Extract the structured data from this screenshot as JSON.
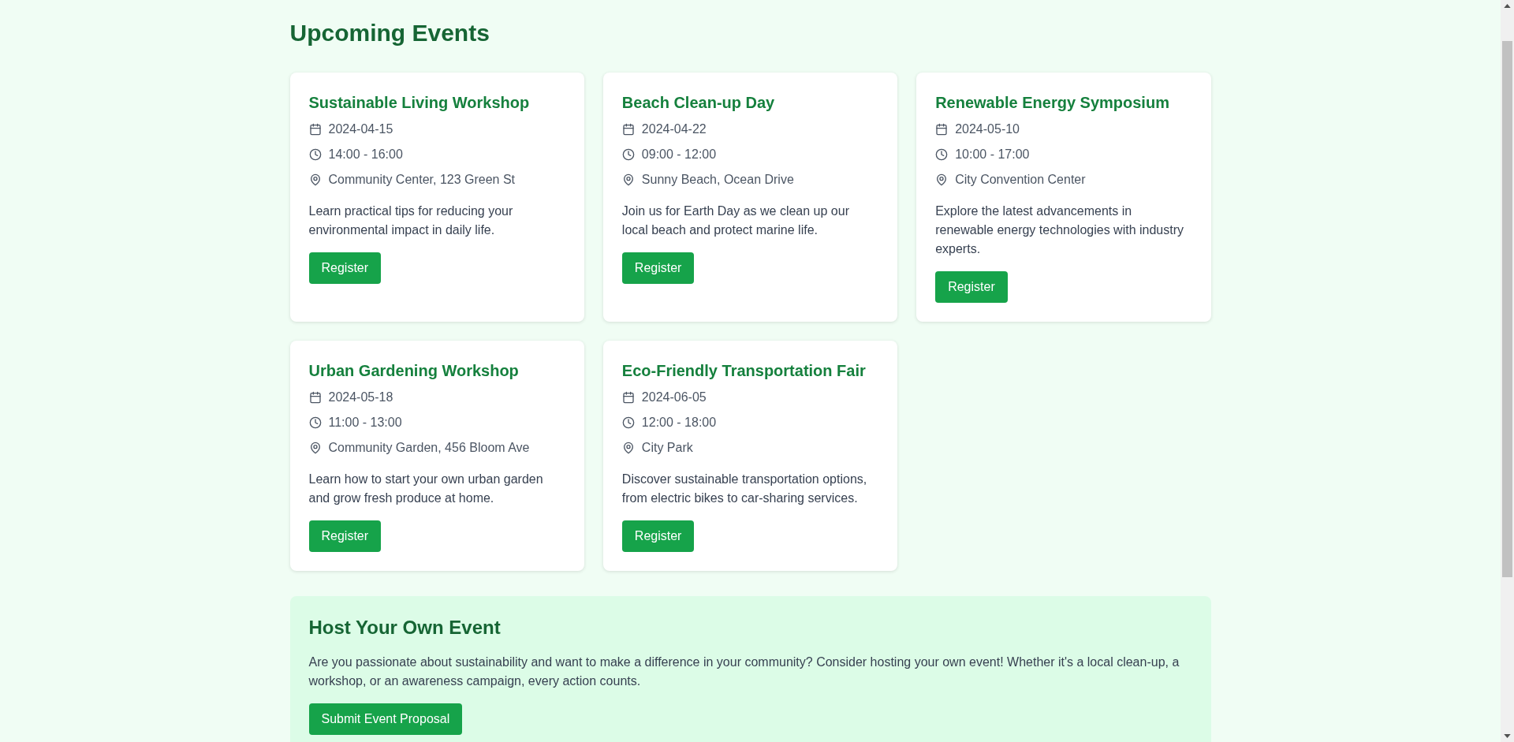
{
  "page_title": "Upcoming Events",
  "events": [
    {
      "title": "Sustainable Living Workshop",
      "date": "2024-04-15",
      "time": "14:00 - 16:00",
      "location": "Community Center, 123 Green St",
      "description": "Learn practical tips for reducing your environmental impact in daily life.",
      "button": "Register"
    },
    {
      "title": "Beach Clean-up Day",
      "date": "2024-04-22",
      "time": "09:00 - 12:00",
      "location": "Sunny Beach, Ocean Drive",
      "description": "Join us for Earth Day as we clean up our local beach and protect marine life.",
      "button": "Register"
    },
    {
      "title": "Renewable Energy Symposium",
      "date": "2024-05-10",
      "time": "10:00 - 17:00",
      "location": "City Convention Center",
      "description": "Explore the latest advancements in renewable energy technologies with industry experts.",
      "button": "Register"
    },
    {
      "title": "Urban Gardening Workshop",
      "date": "2024-05-18",
      "time": "11:00 - 13:00",
      "location": "Community Garden, 456 Bloom Ave",
      "description": "Learn how to start your own urban garden and grow fresh produce at home.",
      "button": "Register"
    },
    {
      "title": "Eco-Friendly Transportation Fair",
      "date": "2024-06-05",
      "time": "12:00 - 18:00",
      "location": "City Park",
      "description": "Discover sustainable transportation options, from electric bikes to car-sharing services.",
      "button": "Register"
    }
  ],
  "host_section": {
    "title": "Host Your Own Event",
    "text": "Are you passionate about sustainability and want to make a difference in your community? Consider hosting your own event! Whether it's a local clean-up, a workshop, or an awareness campaign, every action counts.",
    "button": "Submit Event Proposal"
  }
}
